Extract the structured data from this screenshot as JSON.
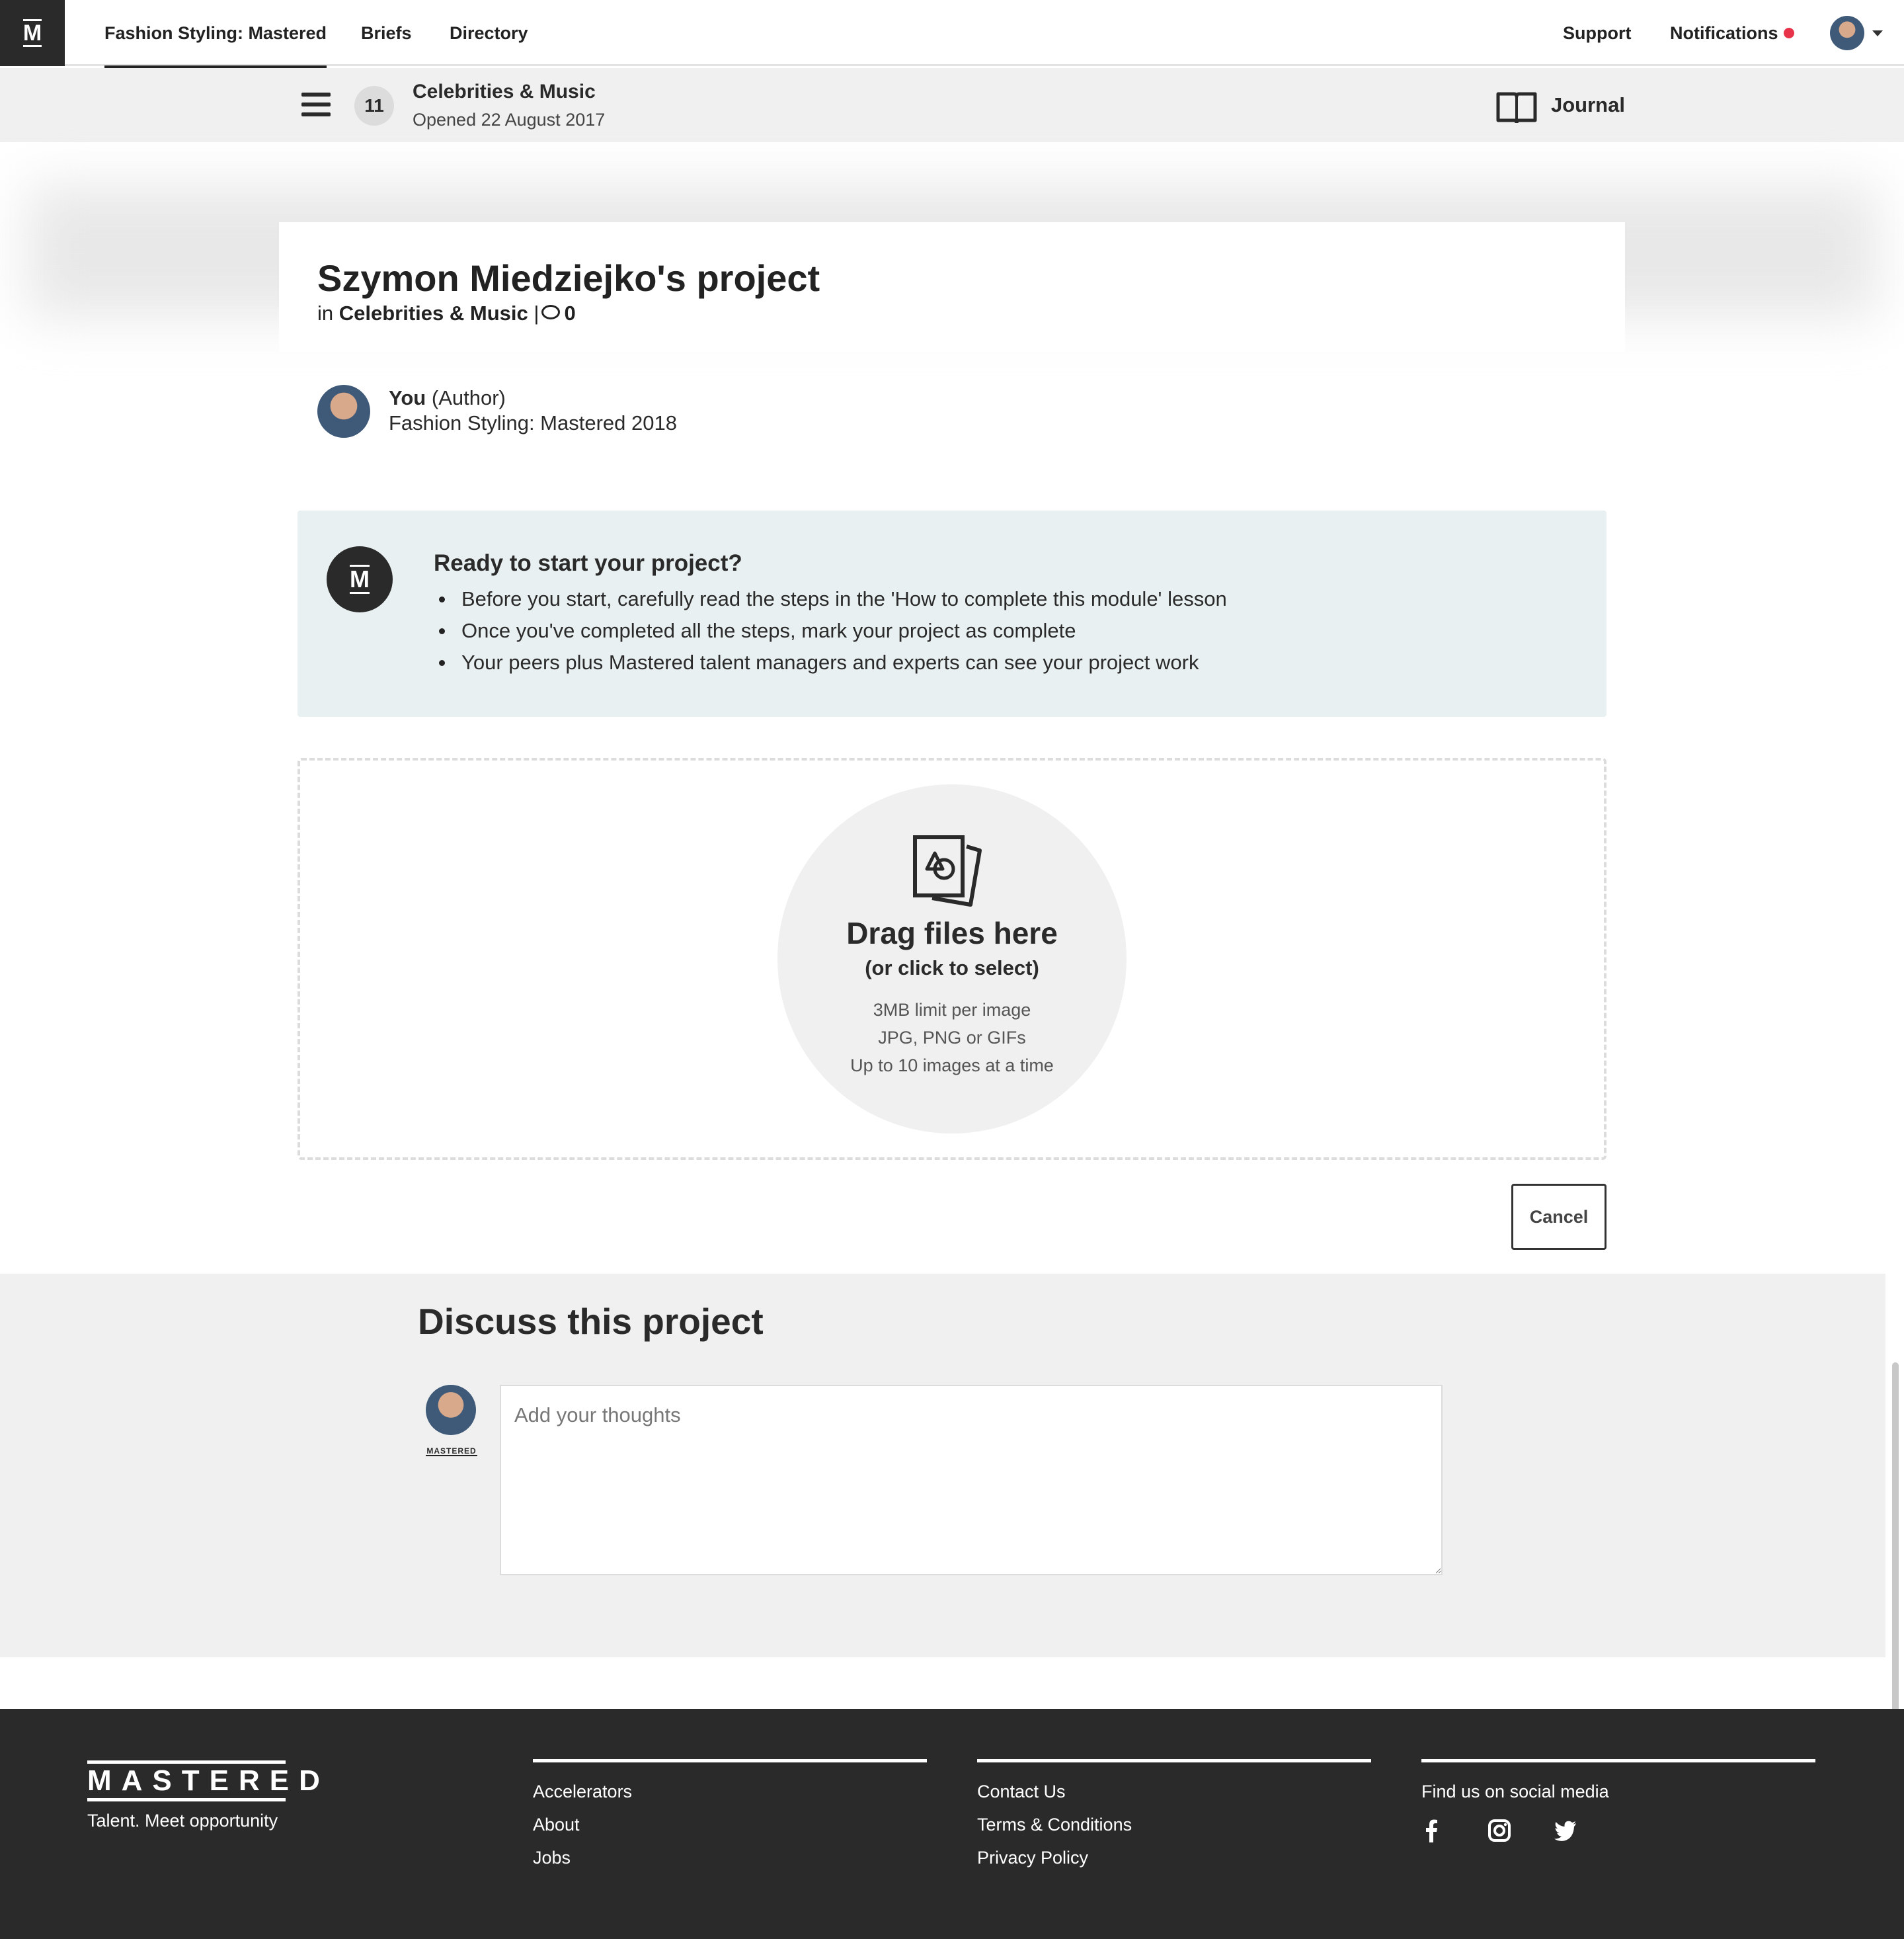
{
  "nav": {
    "course": "Fashion Styling: Mastered",
    "briefs": "Briefs",
    "directory": "Directory",
    "support": "Support",
    "notifications": "Notifications"
  },
  "subheader": {
    "number": "11",
    "title": "Celebrities & Music",
    "opened": "Opened 22 August 2017",
    "journal": "Journal"
  },
  "project": {
    "title": "Szymon Miedziejko's project",
    "in_label": "in",
    "category": "Celebrities & Music",
    "separator": "|",
    "comment_count": "0"
  },
  "author": {
    "name": "You",
    "role": "(Author)",
    "course": "Fashion Styling: Mastered 2018"
  },
  "info": {
    "title": "Ready to start your project?",
    "items": [
      "Before you start, carefully read the steps in the 'How to complete this module' lesson",
      "Once you've completed all the steps, mark your project as complete",
      "Your peers plus Mastered talent managers and experts can see your project work"
    ]
  },
  "dropzone": {
    "title": "Drag files here",
    "subtitle": "(or click to select)",
    "notes": [
      "3MB limit per image",
      "JPG, PNG or GIFs",
      "Up to 10 images at a time"
    ]
  },
  "cancel": "Cancel",
  "discussion": {
    "title": "Discuss this project",
    "placeholder": "Add your thoughts",
    "badge": "MASTERED"
  },
  "footer": {
    "logo": "MASTERED",
    "tagline": "Talent. Meet opportunity",
    "col1": [
      "Accelerators",
      "About",
      "Jobs"
    ],
    "col2": [
      "Contact Us",
      "Terms & Conditions",
      "Privacy Policy"
    ],
    "social_title": "Find us on social media",
    "social_icons": [
      "facebook-icon",
      "instagram-icon",
      "twitter-icon"
    ]
  },
  "colors": {
    "notification_dot": "#e8344a",
    "dark": "#2a2a2a",
    "info_bg": "#e9f0f1",
    "grey_bg": "#f0f0f0"
  }
}
